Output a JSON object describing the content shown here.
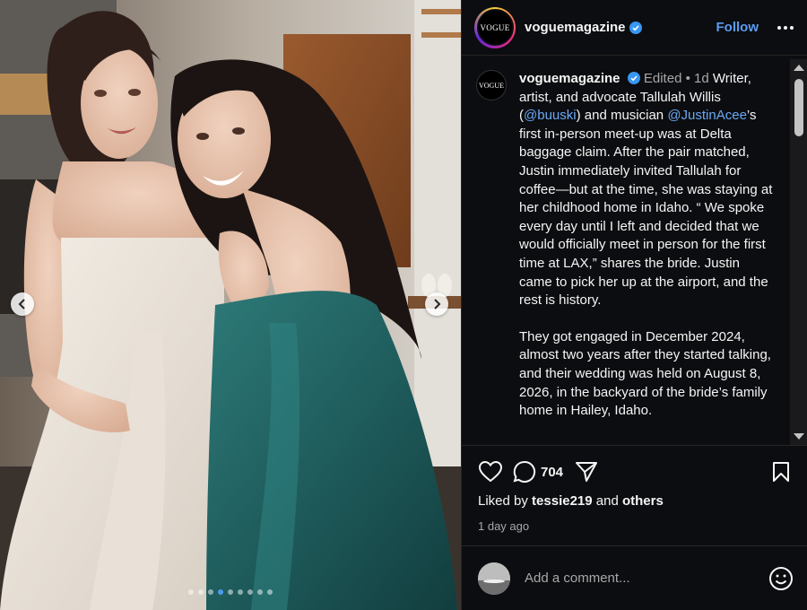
{
  "post": {
    "username": "voguemagazine",
    "avatar_text": "VOGUE",
    "follow_label": "Follow",
    "edited_label": "Edited",
    "separator": "•",
    "age": "1d",
    "caption_segments": [
      {
        "text": "Writer, artist, and advocate Tallulah Willis (",
        "mention": false
      },
      {
        "text": "@buuski",
        "mention": true
      },
      {
        "text": ") and musician ",
        "mention": false
      },
      {
        "text": "@JustinAcee",
        "mention": true
      },
      {
        "text": "’s first in-person meet-up was at Delta baggage claim. After the pair matched, Justin immediately invited Tallulah for coffee—but at the time, she was staying at her childhood home in Idaho. “ We spoke every day until I left and decided that we would officially meet in person for the first time at LAX,” shares the bride. Justin came to pick her up at the airport, and the rest is history.",
        "mention": false
      }
    ],
    "caption_para2": "They got engaged in December 2024, almost two years after they started talking, and their wedding was held on August 8, 2026, in the backyard of the bride’s family home in Hailey, Idaho.",
    "comment_count": "704",
    "likes": {
      "prefix": "Liked by",
      "user": "tessie219",
      "joiner": "and",
      "others": "others"
    },
    "time_ago": "1 day ago",
    "comment_placeholder": "Add a comment..."
  },
  "carousel": {
    "slide_count": 9,
    "active_index": 3
  },
  "colors": {
    "accent": "#5b9cf0",
    "mention": "#6aa9f5",
    "panel_bg": "#0c0d10",
    "dress_teal": "#1f5c5c"
  },
  "icons": [
    "verified-badge-icon",
    "more-options-icon",
    "heart-icon",
    "comment-icon",
    "share-icon",
    "bookmark-icon",
    "emoji-icon",
    "chevron-left-icon",
    "chevron-right-icon"
  ]
}
